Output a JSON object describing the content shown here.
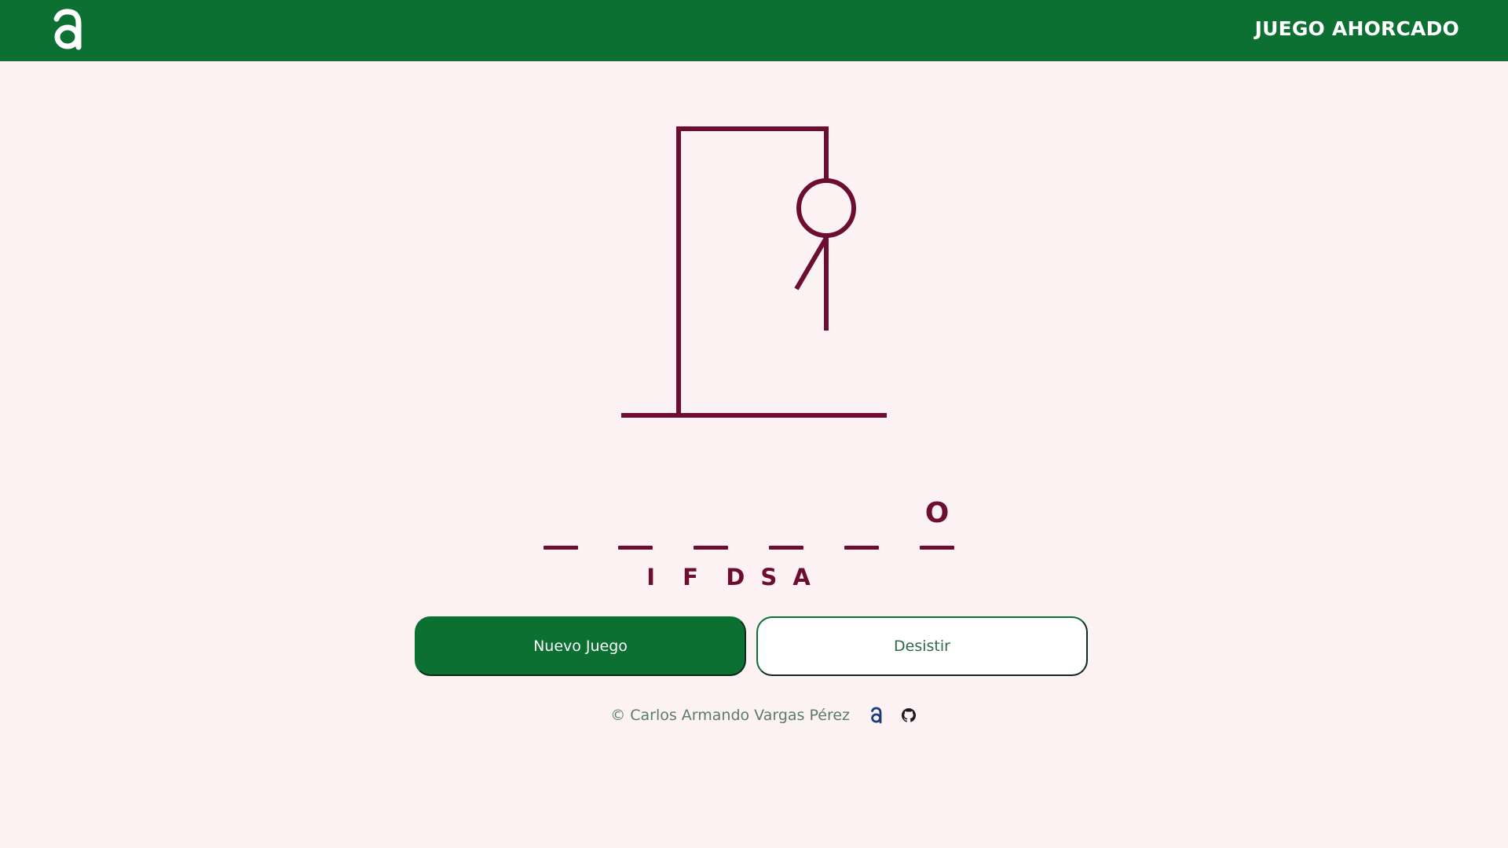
{
  "header": {
    "title": "JUEGO AHORCADO",
    "logo_icon": "a-logo-icon"
  },
  "game": {
    "slots": [
      "",
      "",
      "",
      "",
      "",
      "O"
    ],
    "wrong_letters": "I  F  D S A",
    "drawing_parts": [
      "base",
      "post",
      "beam",
      "rope",
      "head",
      "body",
      "left-arm"
    ]
  },
  "buttons": {
    "new_game": "Nuevo Juego",
    "give_up": "Desistir"
  },
  "footer": {
    "copyright": "© Carlos Armando Vargas Pérez",
    "icons": [
      "a-logo-icon",
      "github-icon"
    ]
  },
  "colors": {
    "header": "#0b7031",
    "background": "#fcf2f4",
    "accent": "#6c0d31",
    "footer_text": "#5a7c66"
  }
}
